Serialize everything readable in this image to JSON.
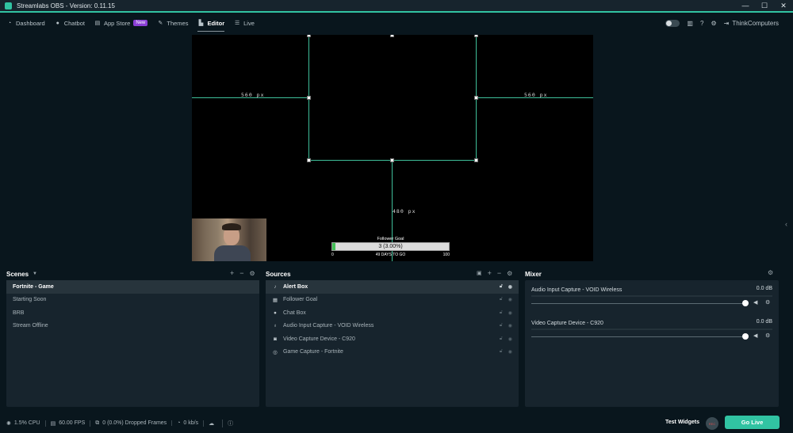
{
  "window": {
    "title": "Streamlabs OBS - Version: 0.11.15",
    "minimize": "—",
    "maximize": "☐",
    "close": "✕"
  },
  "nav": {
    "items": [
      {
        "label": "Dashboard",
        "icon": "dashboard-icon"
      },
      {
        "label": "Chatbot",
        "icon": "chatbot-icon"
      },
      {
        "label": "App Store",
        "icon": "store-icon",
        "badge": "New"
      },
      {
        "label": "Themes",
        "icon": "themes-icon"
      },
      {
        "label": "Editor",
        "icon": "editor-icon",
        "active": true
      },
      {
        "label": "Live",
        "icon": "live-icon"
      }
    ],
    "user": "ThinkComputers"
  },
  "preview": {
    "left_dim": "560 px",
    "right_dim": "560 px",
    "bottom_dim": "480 px",
    "goal": {
      "title": "Follower Goal",
      "value": "3 (3.00%)",
      "start": "0",
      "days": "49 DAYS TO GO",
      "end": "100",
      "progress": 0.03
    }
  },
  "scenes": {
    "title": "Scenes",
    "items": [
      {
        "label": "Fortnite - Game",
        "selected": true
      },
      {
        "label": "Starting Soon"
      },
      {
        "label": "BRB"
      },
      {
        "label": "Stream Offline"
      }
    ]
  },
  "sources": {
    "title": "Sources",
    "items": [
      {
        "label": "Alert Box",
        "icon": "bell-icon",
        "selected": true
      },
      {
        "label": "Follower Goal",
        "icon": "calendar-icon"
      },
      {
        "label": "Chat Box",
        "icon": "chat-icon"
      },
      {
        "label": "Audio Input Capture - VOID Wireless",
        "icon": "microphone-icon"
      },
      {
        "label": "Video Capture Device - C920",
        "icon": "webcam-icon"
      },
      {
        "label": "Game Capture - Fortnite",
        "icon": "gamepad-icon"
      }
    ]
  },
  "mixer": {
    "title": "Mixer",
    "items": [
      {
        "label": "Audio Input Capture - VOID Wireless",
        "db": "0.0 dB",
        "level": 1.0
      },
      {
        "label": "Video Capture Device - C920",
        "db": "0.0 dB",
        "level": 1.0
      }
    ]
  },
  "status": {
    "cpu": "1.5% CPU",
    "fps": "60.00 FPS",
    "dropped": "0 (0.0%) Dropped Frames",
    "kbs": "0 kb/s",
    "test_widgets": "Test Widgets",
    "rec": "REC",
    "go_live": "Go Live"
  },
  "colors": {
    "accent": "#31c3a2",
    "badge": "#8b3fd6",
    "background": "#09161d",
    "panel": "#17242d"
  }
}
